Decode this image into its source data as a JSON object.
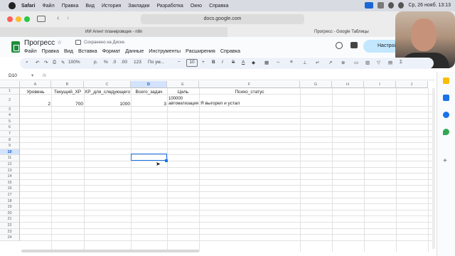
{
  "menubar": {
    "app": "Safari",
    "items": [
      "Файл",
      "Правка",
      "Вид",
      "История",
      "Закладки",
      "Разработка",
      "Окно",
      "Справка"
    ],
    "clock": "Ср, 26 нояб. 13:13"
  },
  "browser": {
    "url": "docs.google.com",
    "tabs": [
      "ИИ Агент планировщик - n8n",
      "Прогресс - Google Таблицы"
    ]
  },
  "sheets": {
    "title": "Прогресс",
    "saved_status": "Сохранено на Диске.",
    "menus": [
      "Файл",
      "Правка",
      "Вид",
      "Вставка",
      "Формат",
      "Данные",
      "Инструменты",
      "Расширения",
      "Справка"
    ],
    "share_label": "Настрой",
    "toolbar": {
      "zoom": "100%",
      "currency": "р.",
      "percent": "%",
      "dec_less": ".0",
      "dec_more": ".00",
      "num_format": "123",
      "font": "По ум...",
      "font_size": "10",
      "bold": "B",
      "italic": "I",
      "strike": "S",
      "text_color": "A"
    },
    "name_box": "D10",
    "fx": "fx",
    "columns": [
      "A",
      "B",
      "C",
      "D",
      "E",
      "F",
      "G",
      "H",
      "I",
      "J"
    ],
    "rows": [
      "1",
      "2",
      "3",
      "4",
      "5",
      "6",
      "7",
      "8",
      "9",
      "10",
      "11",
      "12",
      "13",
      "14",
      "15",
      "16",
      "17",
      "18",
      "19",
      "20",
      "21",
      "22",
      "23",
      "24"
    ],
    "cells": {
      "A1": "Уровень",
      "B1": "Текущий_XP",
      "C1": "XP_для_следующего",
      "D1": "Всего_задач",
      "E1": "Цель",
      "F1": "Психо_статус",
      "A2": "2",
      "B2": "700",
      "C2": "1000",
      "D2": "3",
      "E2a": "100000",
      "E2b": "автоматизация",
      "F2": "Я выгорел и устал"
    }
  }
}
